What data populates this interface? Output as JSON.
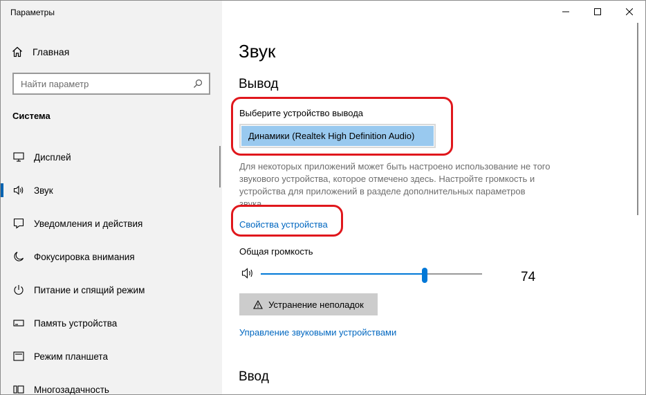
{
  "window": {
    "title": "Параметры"
  },
  "sidebar": {
    "home_label": "Главная",
    "search_placeholder": "Найти параметр",
    "section_title": "Система",
    "items": [
      {
        "label": "Дисплей",
        "icon": "monitor-icon"
      },
      {
        "label": "Звук",
        "icon": "speaker-icon",
        "active": true
      },
      {
        "label": "Уведомления и действия",
        "icon": "notification-icon"
      },
      {
        "label": "Фокусировка внимания",
        "icon": "moon-icon"
      },
      {
        "label": "Питание и спящий режим",
        "icon": "power-icon"
      },
      {
        "label": "Память устройства",
        "icon": "storage-icon"
      },
      {
        "label": "Режим планшета",
        "icon": "tablet-icon"
      },
      {
        "label": "Многозадачность",
        "icon": "multitask-icon"
      }
    ]
  },
  "main": {
    "page_title": "Звук",
    "output_heading": "Вывод",
    "output_device_label": "Выберите устройство вывода",
    "output_device_selected": "Динамики (Realtek High Definition Audio)",
    "description": "Для некоторых приложений может быть настроено использование не того звукового устройства, которое отмечено здесь. Настройте громкость и устройства для приложений в разделе дополнительных параметров звука.",
    "device_properties_link": "Свойства устройства",
    "volume_label": "Общая громкость",
    "volume_value": "74",
    "volume_fraction": 0.74,
    "troubleshoot_label": "Устранение неполадок",
    "manage_devices_link": "Управление звуковыми устройствами",
    "input_heading": "Ввод"
  },
  "colors": {
    "accent": "#0078d7",
    "highlight_annotation": "#e0171c",
    "selected_bg": "#99c9ef"
  }
}
